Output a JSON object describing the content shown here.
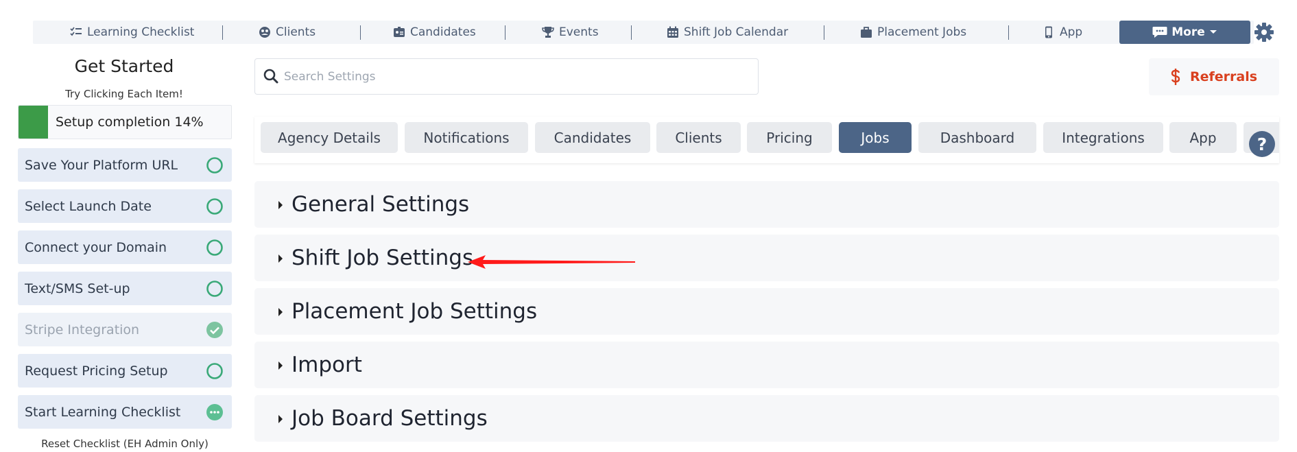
{
  "nav": {
    "items": [
      {
        "label": "Learning Checklist",
        "icon": "checklist-icon"
      },
      {
        "label": "Clients",
        "icon": "clients-icon"
      },
      {
        "label": "Candidates",
        "icon": "id-badge-icon"
      },
      {
        "label": "Events",
        "icon": "trophy-icon"
      },
      {
        "label": "Shift Job Calendar",
        "icon": "calendar-icon"
      },
      {
        "label": "Placement Jobs",
        "icon": "briefcase-icon"
      },
      {
        "label": "App",
        "icon": "phone-icon"
      }
    ],
    "more_label": "More",
    "settings_icon": "gear-icon"
  },
  "sidebar": {
    "title": "Get Started",
    "subtitle": "Try Clicking Each Item!",
    "progress_label": "Setup completion 14%",
    "progress_fraction": 0.14,
    "items": [
      {
        "label": "Save Your Platform URL",
        "status": "pending"
      },
      {
        "label": "Select Launch Date",
        "status": "pending"
      },
      {
        "label": "Connect your Domain",
        "status": "pending"
      },
      {
        "label": "Text/SMS Set-up",
        "status": "pending"
      },
      {
        "label": "Stripe Integration",
        "status": "done"
      },
      {
        "label": "Request Pricing Setup",
        "status": "pending"
      },
      {
        "label": "Start Learning Checklist",
        "status": "in-progress"
      }
    ],
    "reset_label": "Reset Checklist (EH Admin Only)"
  },
  "search": {
    "placeholder": "Search Settings",
    "value": ""
  },
  "referrals": {
    "label": "Referrals",
    "icon": "dollar-icon"
  },
  "tabs": {
    "items": [
      "Agency Details",
      "Notifications",
      "Candidates",
      "Clients",
      "Pricing",
      "Jobs",
      "Dashboard",
      "Integrations",
      "App"
    ],
    "active": "Jobs",
    "help_label": "?"
  },
  "sections": [
    "General Settings",
    "Shift Job Settings",
    "Placement Job Settings",
    "Import",
    "Job Board Settings"
  ],
  "colors": {
    "accent": "#4c6587",
    "progress": "#3c9b48",
    "referrals": "#d9401e",
    "pending_ring": "#3aa978",
    "done_check": "#7dc4a0",
    "annotation_arrow": "#ff1a1a"
  }
}
